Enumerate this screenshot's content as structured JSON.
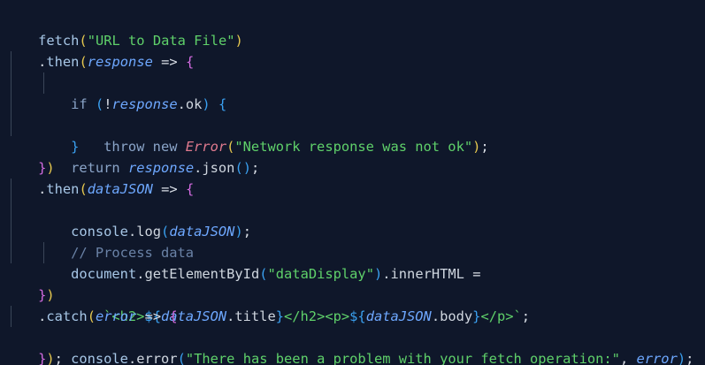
{
  "code": {
    "l1": {
      "fn": "fetch",
      "open": "(",
      "str": "\"URL to Data File\"",
      "close": ")"
    },
    "l2": {
      "dot": ".",
      "fn": "then",
      "open": "(",
      "param": "response",
      "arrow": " => ",
      "brace": "{"
    },
    "l3": {
      "kw": "if",
      "sp": " ",
      "open": "(",
      "not": "!",
      "param": "response",
      "prop": ".ok",
      "close": ")",
      "sp2": " ",
      "brace": "{"
    },
    "l4": {
      "kw": "throw new",
      "sp": " ",
      "cls": "Error",
      "open": "(",
      "str": "\"Network response was not ok\"",
      "close": ")",
      "semi": ";"
    },
    "l5": {
      "brace": "}"
    },
    "l6": {
      "kw": "return",
      "sp": " ",
      "param": "response",
      "prop": ".json",
      "open": "(",
      "close": ")",
      "semi": ";"
    },
    "l7": {
      "brace": "}",
      "close": ")"
    },
    "l8": {
      "dot": ".",
      "fn": "then",
      "open": "(",
      "param": "dataJSON",
      "arrow": " => ",
      "brace": "{"
    },
    "l9": {
      "obj": "console",
      "prop": ".log",
      "open": "(",
      "param": "dataJSON",
      "close": ")",
      "semi": ";"
    },
    "l10": {
      "comment": "// Process data"
    },
    "l11": {
      "obj": "document",
      "prop": ".getElementById",
      "open": "(",
      "str": "\"dataDisplay\"",
      "close": ")",
      "prop2": ".innerHTML",
      "eq": " ="
    },
    "l12": {
      "t1": "`<h2>",
      "d1": "${",
      "p1": "dataJSON",
      "pr1": ".title",
      "e1": "}",
      "t2": "</h2><p>",
      "d2": "${",
      "p2": "dataJSON",
      "pr2": ".body",
      "e2": "}",
      "t3": "</p>`",
      "semi": ";"
    },
    "l13": {
      "brace": "}",
      "close": ")"
    },
    "l14": {
      "dot": ".",
      "fn": "catch",
      "open": "(",
      "param": "error",
      "arrow": " => ",
      "brace": "{"
    },
    "l15": {
      "obj": "console",
      "prop": ".error",
      "open": "(",
      "str": "\"There has been a problem with your fetch operation:\"",
      "comma": ", ",
      "param": "error",
      "close": ")",
      "semi": ";"
    },
    "l16": {
      "brace": "}",
      "close": ")",
      "semi": ";"
    }
  }
}
